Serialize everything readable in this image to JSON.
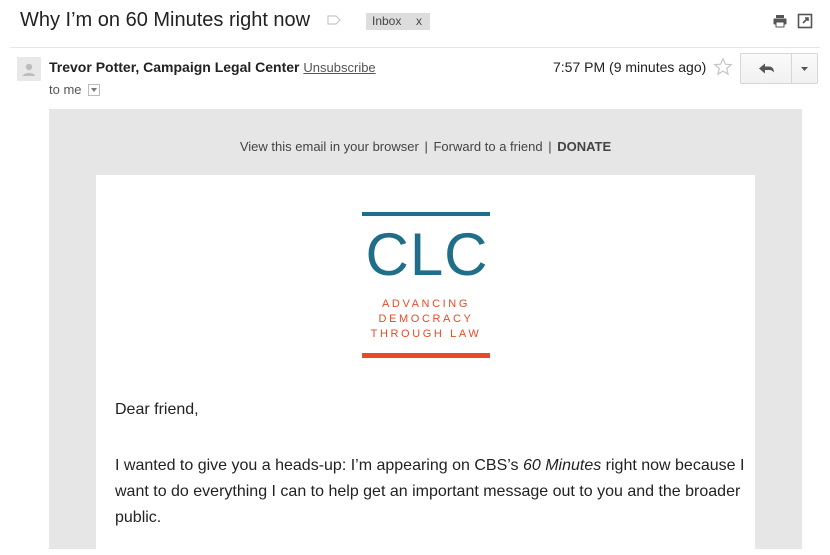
{
  "subject": "Why I’m on 60 Minutes right now",
  "label_chip": {
    "text": "Inbox",
    "remove": "x"
  },
  "top_actions": [
    "print-icon",
    "new-window-icon"
  ],
  "sender": {
    "name": "Trevor Potter, Campaign Legal Center",
    "unsubscribe": "Unsubscribe",
    "time": "7:57 PM (9 minutes ago)",
    "to": "to me"
  },
  "email": {
    "preheader": {
      "view_in_browser": "View this email in your browser",
      "sep1": "|",
      "forward": "Forward to a friend",
      "sep2": "|",
      "donate": "DONATE"
    },
    "logo": {
      "text": "CLC",
      "tagline": [
        "ADVANCING",
        "DEMOCRACY",
        "THROUGH LAW"
      ],
      "colors": {
        "teal": "#1f6f8b",
        "orange": "#e84a26"
      }
    },
    "greeting": "Dear friend,",
    "para1_before": "I wanted to give you a heads-up: I’m appearing on CBS’s ",
    "para1_italic": "60 Minutes",
    "para1_after": " right now because I want to do everything I can to help get an important message out to you and the broader public."
  }
}
